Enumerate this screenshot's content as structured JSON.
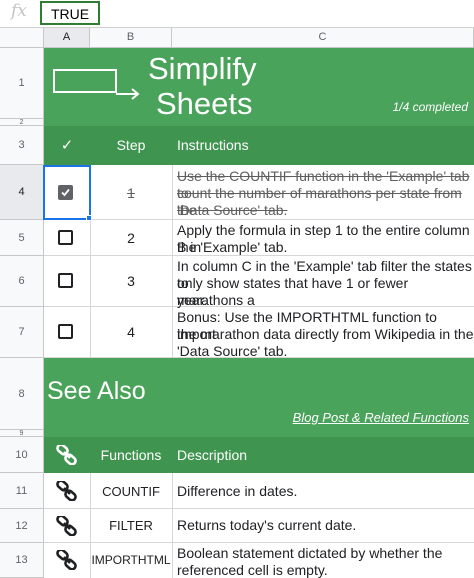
{
  "formula_bar": {
    "fx_label": "fx",
    "value": "TRUE"
  },
  "columns": [
    "A",
    "B",
    "C"
  ],
  "rows": [
    "1",
    "2",
    "3",
    "4",
    "5",
    "6",
    "7",
    "8",
    "9",
    "10",
    "11",
    "12",
    "13"
  ],
  "banner": {
    "title_line1": "Simplify",
    "title_line2": "Sheets",
    "progress": "1/4 completed"
  },
  "steps_header": {
    "check": "✓",
    "step": "Step",
    "instructions": "Instructions"
  },
  "steps": [
    {
      "checked": true,
      "number": "1",
      "lines": [
        "Use the COUNTIF function in the 'Example' tab to",
        "count the number of marathons per state from the",
        "'Data Source' tab."
      ]
    },
    {
      "checked": false,
      "number": "2",
      "lines": [
        "Apply the formula in step 1 to the entire column B in",
        "the 'Example' tab."
      ]
    },
    {
      "checked": false,
      "number": "3",
      "lines": [
        "In column C in the 'Example' tab filter the states to",
        "only show states that have 1 or fewer marathons a",
        "year."
      ]
    },
    {
      "checked": false,
      "number": "4",
      "lines": [
        "Bonus: Use the IMPORTHTML function to import",
        "the marathon data directly from Wikipedia in the",
        "'Data Source' tab."
      ]
    }
  ],
  "see_also": {
    "title": "See Also",
    "link": "Blog Post & Related Functions"
  },
  "functions_header": {
    "functions": "Functions",
    "description": "Description"
  },
  "functions": [
    {
      "name": "COUNTIF",
      "lines": [
        "Difference in dates."
      ]
    },
    {
      "name": "FILTER",
      "lines": [
        "Returns today's current date."
      ]
    },
    {
      "name": "IMPORTHTML",
      "lines": [
        "Boolean statement dictated by whether the",
        "referenced cell is empty."
      ]
    }
  ]
}
